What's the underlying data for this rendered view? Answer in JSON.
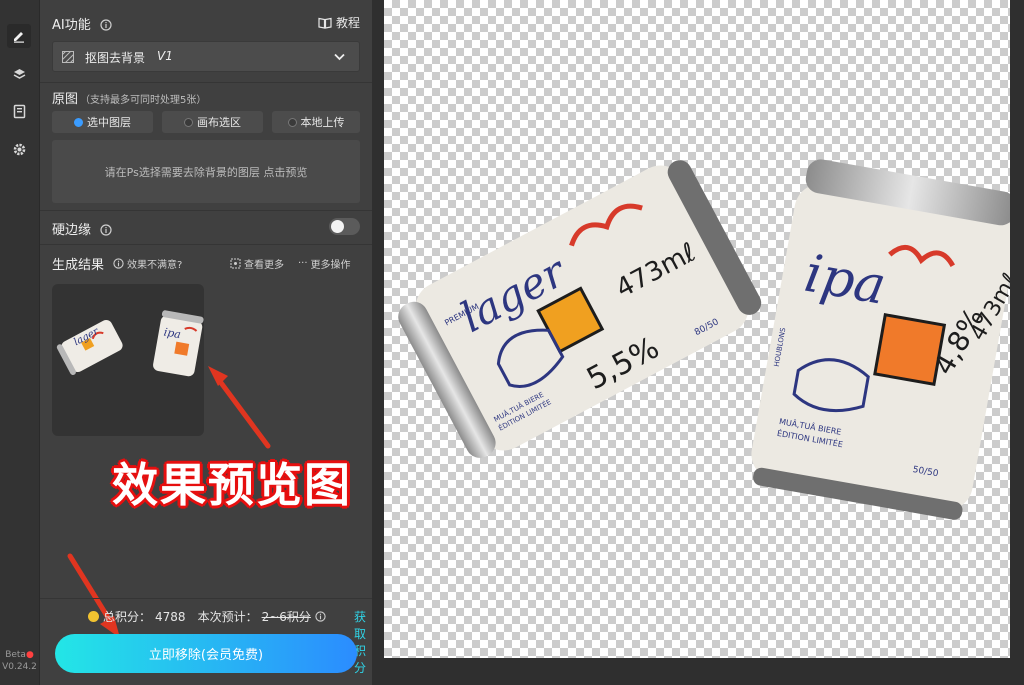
{
  "sidebar": {
    "version_badge": "Beta",
    "version": "V0.24.2"
  },
  "ai_function": {
    "title": "AI功能",
    "tutorial_label": "教程",
    "selected_tool": "抠图去背景",
    "selected_tool_version": "V1"
  },
  "source": {
    "title": "原图",
    "subtitle": "（支持最多可同时处理5张）",
    "options": [
      {
        "label": "选中图层",
        "selected": true
      },
      {
        "label": "画布选区",
        "selected": false
      },
      {
        "label": "本地上传",
        "selected": false
      }
    ],
    "hint": "请在Ps选择需要去除背景的图层 点击预览"
  },
  "hard_edge": {
    "label": "硬边缘",
    "enabled": false
  },
  "results": {
    "title": "生成结果",
    "not_satisfied": "效果不满意?",
    "view_more": "查看更多",
    "more_actions": "更多操作"
  },
  "annotation": {
    "text": "效果预览图"
  },
  "footer": {
    "total_points_label": "总积分：",
    "total_points": "4788",
    "estimate_label": "本次预计：",
    "estimate_value": "2~6积分",
    "get_points": "获取积分",
    "cta": "立即移除(会员免费)"
  },
  "cans": [
    {
      "brand": "lager",
      "abv": "5,5%",
      "volume": "473mℓ",
      "tag": "PREMIUM",
      "line1": "MUÂ,TUÂ BIERE",
      "line2": "ÉDITION LIMITÉE",
      "num": "80/50",
      "accent": "#f0a020"
    },
    {
      "brand": "ipa",
      "abv": "4,8%",
      "volume": "473mℓ",
      "tag": "HOUBLONS",
      "line1": "MUÂ,TUÂ BIERE",
      "line2": "ÉDITION LIMITÉE",
      "num": "50/50",
      "accent": "#f07a2a"
    }
  ],
  "colors": {
    "panel": "#404040",
    "accent_blue": "#3b9cff",
    "cta_start": "#23e6e6",
    "cta_end": "#2b8cff",
    "annotation_red": "#e60f0f"
  }
}
